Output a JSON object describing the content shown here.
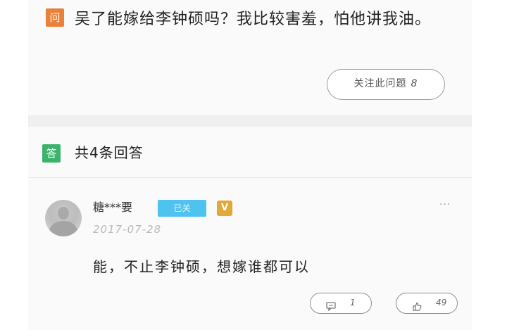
{
  "question": {
    "badge": "问",
    "text": "吴了能嫁给李钟硕吗？我比较害羞，怕他讲我油。",
    "follow_label": "关注此问题",
    "follow_count": "8"
  },
  "answers_header": {
    "badge": "答",
    "count_text": "共4条回答"
  },
  "answer": {
    "username": "糖***要",
    "status_tag": "已关",
    "level_badge": "V",
    "date": "2017-07-28",
    "text": "能，不止李钟硕，想嫁谁都可以",
    "comment_count": "1",
    "like_count": "49",
    "more_glyph": "···"
  },
  "colors": {
    "question_badge": "#e8823a",
    "answer_badge": "#3bb36a",
    "status_tag": "#4fc3f0",
    "level_badge": "#e2a83a"
  },
  "icons": [
    "more-dots-icon",
    "comment-icon",
    "like-icon"
  ]
}
